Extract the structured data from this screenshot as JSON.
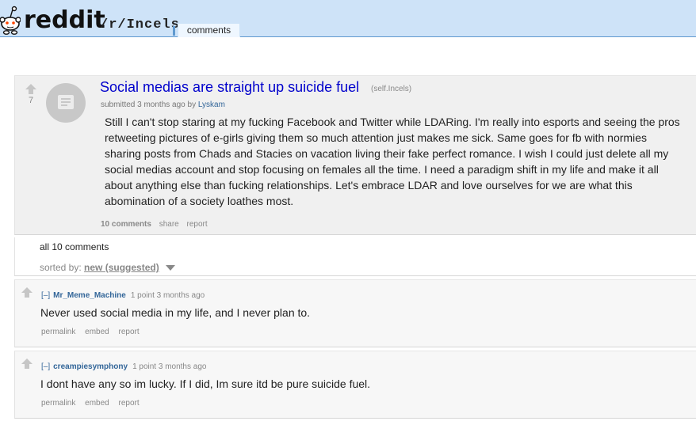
{
  "header": {
    "logo_text": "reddit",
    "subreddit": "/r/Incels",
    "tab_label": "comments",
    "accent_bg": "#cee3f8",
    "accent_border": "#5f99cf"
  },
  "post": {
    "score": "7",
    "title": "Social medias are straight up suicide fuel",
    "domain": "(self.Incels)",
    "submitted": "submitted 3 months ago by",
    "author": "Lyskam",
    "selftext": "Still I can't stop staring at my fucking Facebook and Twitter while LDARing. I'm really into esports and seeing the pros retweeting pictures of e-girls giving them so much attention just makes me sick. Same goes for fb with normies sharing posts from Chads and Stacies on vacation living their fake perfect romance. I wish I could just delete all my social medias account and stop focusing on females all the time. I need a paradigm shift in my life and make it all about anything else than fucking relationships. Let's embrace LDAR and love ourselves for we are what this abomination of a society loathes most.",
    "buttons": {
      "comments": "10 comments",
      "share": "share",
      "report": "report"
    },
    "thumbnail_icon": "self-post-icon"
  },
  "comments_section": {
    "all_comments": "all 10 comments",
    "sort_label": "sorted by:",
    "sort_value": "new (suggested)"
  },
  "comments": [
    {
      "toggle": "[–]",
      "user": "Mr_Meme_Machine",
      "meta": "1 point 3 months ago",
      "body": "Never used social media in my life, and I never plan to.",
      "buttons": {
        "permalink": "permalink",
        "embed": "embed",
        "report": "report"
      }
    },
    {
      "toggle": "[–]",
      "user": "creampiesymphony",
      "meta": "1 point 3 months ago",
      "body": "I dont have any so im lucky. If I did, Im sure itd be pure suicide fuel.",
      "buttons": {
        "permalink": "permalink",
        "embed": "embed",
        "report": "report"
      }
    }
  ]
}
